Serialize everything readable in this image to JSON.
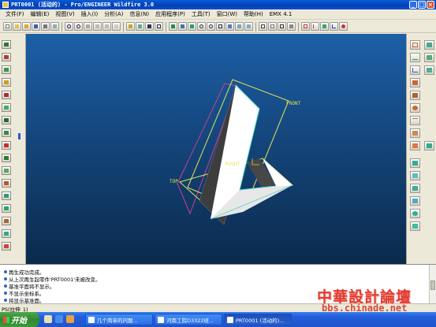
{
  "window": {
    "title": "PRT0001 (活动的) - Pro/ENGINEER Wildfire 3.0"
  },
  "menu": [
    "文件(F)",
    "编辑(E)",
    "视图(V)",
    "插入(I)",
    "分析(A)",
    "信息(N)",
    "应用程序(P)",
    "工具(T)",
    "窗口(W)",
    "帮助(H)",
    "EMX 4.1"
  ],
  "toolbar": {
    "icons": [
      "new-icon",
      "open-icon",
      "folder-icon",
      "save-icon",
      "print-icon",
      "email-icon",
      "undo-icon",
      "redo-icon",
      "cut-icon",
      "copy-icon",
      "paste-icon",
      "paste-special-icon",
      "regenerate-icon",
      "regen-manager-icon",
      "find-icon",
      "select-icon",
      "spin-center-icon",
      "orient-icon",
      "repaint-icon",
      "zoom-in-icon",
      "zoom-out-icon",
      "refit-icon",
      "reorient-icon",
      "saved-views-icon",
      "layers-icon",
      "wireframe-icon",
      "hidden-line-icon",
      "no-hidden-icon",
      "shading-icon",
      "datum-planes-icon",
      "datum-axes-icon",
      "datum-points-icon",
      "coord-sys-icon",
      "context-help-icon"
    ]
  },
  "viewport": {
    "datum_labels": {
      "front": "FRONT",
      "top": "TOP",
      "right": "RIGHT"
    },
    "colors": {
      "background_top": "#1d5fa7",
      "background_bottom": "#0b2a4c",
      "datum_yellow": "#e4e35a",
      "datum_magenta": "#c9408f",
      "model_white": "#ffffff",
      "model_dark": "#3d3d3d",
      "edge_cyan": "#4fd6c8"
    }
  },
  "messages": [
    "再生成功完成。",
    "从上次再生起零件'PRT0001'未被改变。",
    "基准平面将不显示。",
    "不显示坐标系。",
    "将显示基准面。"
  ],
  "status": {
    "text": "PS(拉伸_1)"
  },
  "watermark": {
    "text": "中華設計論壇",
    "url": "bbs.chinade.net"
  },
  "taskbar": {
    "start": "开始",
    "tasks": [
      "几个简单的问题...",
      "河南工院D3322班...",
      "PRT0001 (活动的)..."
    ]
  }
}
